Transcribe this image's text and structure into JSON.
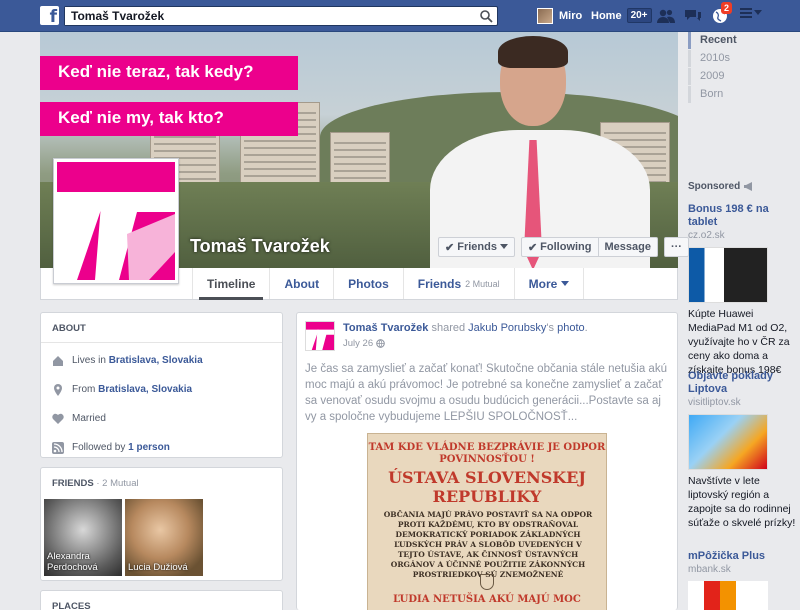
{
  "topbar": {
    "search_value": "Tomaš Tvarožek",
    "user_name": "Miro",
    "home_label": "Home",
    "home_count": "20+",
    "notifications_count": "2"
  },
  "profile": {
    "name": "Tomaš Tvarožek",
    "slogan_1": "Keď nie teraz, tak kedy?",
    "slogan_2": "Keď nie my, tak kto?",
    "buttons": {
      "friends": "Friends",
      "following": "Following",
      "message": "Message",
      "more": "···"
    }
  },
  "tabs": [
    {
      "label": "Timeline"
    },
    {
      "label": "About"
    },
    {
      "label": "Photos"
    },
    {
      "label": "Friends",
      "sub": "2 Mutual"
    },
    {
      "label": "More"
    }
  ],
  "years": [
    "Recent",
    "2010s",
    "2009",
    "Born"
  ],
  "about": {
    "title": "About",
    "lives_prefix": "Lives in",
    "lives": "Bratislava, Slovakia",
    "from_prefix": "From",
    "from": "Bratislava, Slovakia",
    "relationship": "Married",
    "followed_prefix": "Followed by",
    "followed": "1 person"
  },
  "friends_card": {
    "title": "Friends",
    "mutual": "· 2 Mutual",
    "items": [
      {
        "name": "Alexandra Perdochová"
      },
      {
        "name": "Lucia Dužiová"
      }
    ]
  },
  "places_card": {
    "title": "Places"
  },
  "sponsored": {
    "label": "Sponsored",
    "ads": [
      {
        "title": "Bonus 198 € na tablet",
        "url": "cz.o2.sk",
        "text": "Kúpte Huawei MediaPad M1 od O2, využívajte ho v ČR za ceny ako doma a získajte bonus 198€"
      },
      {
        "title": "Objavte poklady Liptova",
        "url": "visitliptov.sk",
        "text": "Navštívte v lete liptovský región a zapojte sa do rodinnej súťaže o skvelé prízky!"
      },
      {
        "title": "mPôžička Plus",
        "url": "mbank.sk"
      }
    ]
  },
  "post": {
    "author": "Tomaš Tvarožek",
    "action": "shared",
    "shared_from": "Jakub Porubsky",
    "possessive": "'s",
    "object": "photo",
    "date": "July 26",
    "text": "Je čas sa zamyslieť a začať konať! Skutočne občania stále netušia akú moc majú a akú právomoc! Je potrebné sa konečne zamyslieť a začať sa venovať osudu svojmu a osudu budúcich generácii...Postavte sa aj vy a spoločne vybudujeme LEPŠIU SPOLOČNOSŤ...",
    "image_lines": {
      "top": "TAM KDE VLÁDNE BEZPRÁVIE JE ODPOR POVINNOSŤOU !",
      "title": "ÚSTAVA SLOVENSKEJ REPUBLIKY",
      "body": "OBČANIA MAJÚ PRÁVO POSTAVIŤ SA NA ODPOR PROTI KAŽDÉMU, KTO BY ODSTRAŇOVAL DEMOKRATICKÝ PORIADOK ZÁKLADNÝCH ĽUDSKÝCH PRÁV A SLOBÔD UVEDENÝCH V TEJTO ÚSTAVE, AK ČINNOSŤ ÚSTAVNÝCH ORGÁNOV A ÚČINNÉ POUŽITIE ZÁKONNÝCH PROSTRIEDKOV SÚ ZNEMOŽNENÉ",
      "bottom": "ĽUDIA NETUŠIA AKÚ MAJÚ MOC"
    }
  },
  "colors": {
    "brand": "#3b5998",
    "accent": "#ec008c",
    "page_bg": "#e9eaed"
  }
}
